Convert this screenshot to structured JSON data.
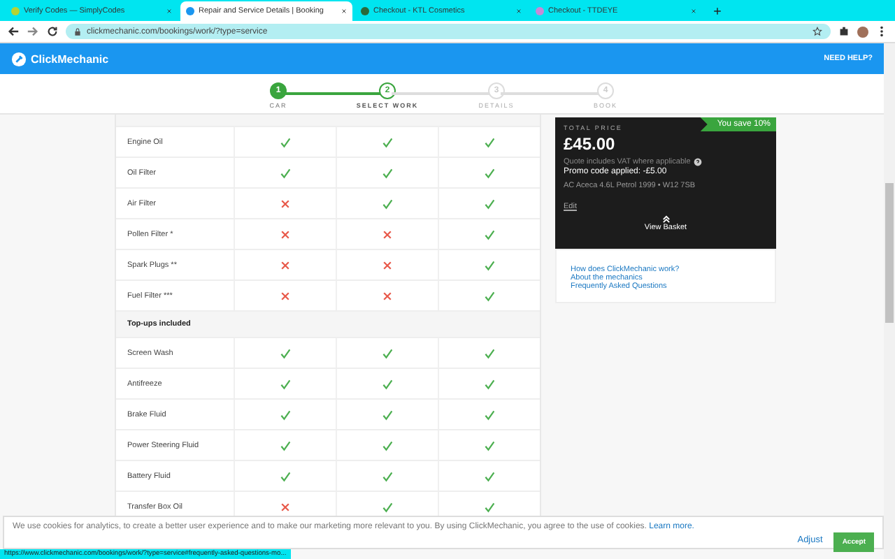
{
  "browser": {
    "tabs": [
      {
        "title": "Verify Codes — SimplyCodes",
        "selected": false
      },
      {
        "title": "Repair and Service Details | Booking",
        "selected": true
      },
      {
        "title": "Checkout - KTL Cosmetics",
        "selected": false
      },
      {
        "title": "Checkout - TTDEYE",
        "selected": false
      }
    ],
    "url": "clickmechanic.com/bookings/work/?type=service"
  },
  "header": {
    "logo": "ClickMechanic",
    "help": "NEED HELP?"
  },
  "steps": [
    {
      "number": "1",
      "label": "CAR",
      "completed": true,
      "selected": false
    },
    {
      "number": "2",
      "label": "SELECT WORK",
      "completed": false,
      "selected": true
    },
    {
      "number": "3",
      "label": "DETAILS",
      "completed": false,
      "selected": false
    },
    {
      "number": "4",
      "label": "BOOK",
      "completed": false,
      "selected": false
    }
  ],
  "table": {
    "sections": [
      {
        "rows": [
          {
            "label": "Engine Oil",
            "cells": [
              true,
              true,
              true
            ]
          },
          {
            "label": "Oil Filter",
            "cells": [
              true,
              true,
              true
            ]
          },
          {
            "label": "Air Filter",
            "cells": [
              false,
              true,
              true
            ]
          },
          {
            "label": "Pollen Filter *",
            "cells": [
              false,
              false,
              true
            ]
          },
          {
            "label": "Spark Plugs **",
            "cells": [
              false,
              false,
              true
            ]
          },
          {
            "label": "Fuel Filter ***",
            "cells": [
              false,
              false,
              true
            ]
          }
        ]
      },
      {
        "title": "Top-ups included",
        "rows": [
          {
            "label": "Screen Wash",
            "cells": [
              true,
              true,
              true
            ]
          },
          {
            "label": "Antifreeze",
            "cells": [
              true,
              true,
              true
            ]
          },
          {
            "label": "Brake Fluid",
            "cells": [
              true,
              true,
              true
            ]
          },
          {
            "label": "Power Steering Fluid",
            "cells": [
              true,
              true,
              true
            ]
          },
          {
            "label": "Battery Fluid",
            "cells": [
              true,
              true,
              true
            ]
          },
          {
            "label": "Transfer Box Oil",
            "cells": [
              false,
              true,
              true
            ]
          }
        ]
      }
    ]
  },
  "basket": {
    "total_label": "TOTAL PRICE",
    "price": "£45.00",
    "saving": "You save 10%",
    "vat_note": "Quote includes VAT where applicable",
    "promo": "Promo code applied: -£5.00",
    "vehicle": "AC Aceca 4.6L Petrol 1999 • W12 7SB",
    "edit": "Edit",
    "view_basket": "View Basket"
  },
  "links": [
    "How does ClickMechanic work?",
    "About the mechanics",
    "Frequently Asked Questions"
  ],
  "cookie_banner": {
    "text": "We use cookies for analytics, to create a better user experience and to make our marketing more relevant to you. By using ClickMechanic, you agree to the use of cookies.",
    "learn_more": "Learn more.",
    "adjust": "Adjust",
    "accept": "Accept"
  },
  "status_url": "https://www.clickmechanic.com/bookings/work/?type=service#frequently-asked-questions-mo..."
}
